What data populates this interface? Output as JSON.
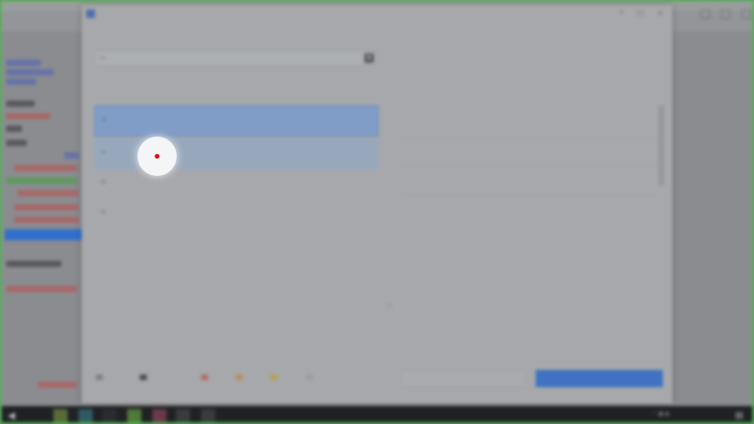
{
  "background_app": {
    "title": "",
    "rows": [
      {
        "color": "blue"
      },
      {
        "color": "blue"
      },
      {
        "color": "blue"
      },
      {
        "color": "dark"
      },
      {
        "color": "red"
      },
      {
        "color": "dark"
      },
      {
        "color": "dark"
      },
      {
        "color": "blue"
      },
      {
        "color": "red"
      },
      {
        "color": "green"
      },
      {
        "color": "red"
      },
      {
        "color": "red"
      },
      {
        "color": "red"
      },
      {
        "color": "red"
      }
    ],
    "bottom_label": "",
    "bottom_sub": ""
  },
  "dialog": {
    "title": "",
    "section_source": "",
    "dropdown": {
      "value": "",
      "icon": "folder-icon"
    },
    "section_left": "",
    "left_items": [
      {
        "title": "",
        "subtitle": "",
        "state": "selected"
      },
      {
        "title": "",
        "subtitle": "",
        "state": "hover"
      },
      {
        "title": "",
        "subtitle": "",
        "state": "normal"
      },
      {
        "title": "",
        "subtitle": "",
        "state": "normal"
      }
    ],
    "section_right": "",
    "right_items": [
      {
        "title": "",
        "subtitle": ""
      },
      {
        "title": "",
        "subtitle": ""
      },
      {
        "title": "",
        "subtitle": ""
      },
      {
        "title": "",
        "subtitle": ""
      }
    ],
    "section_preview": "",
    "preview_text": "",
    "legend": [
      {
        "label": "",
        "color": "#7c7e82"
      },
      {
        "label": "",
        "color": "#4a4b4e"
      },
      {
        "label": "",
        "color": "#b36a6a"
      },
      {
        "label": "",
        "color": "#b98d5a"
      },
      {
        "label": "",
        "color": "#b3a24f"
      },
      {
        "label": "",
        "color": "#9a9c9f"
      }
    ],
    "secondary_button": "",
    "primary_button": ""
  },
  "taskbar": {
    "apps": [
      {
        "icon": "search-icon",
        "active": false
      },
      {
        "icon": "folder-icon",
        "active": false
      },
      {
        "icon": "browser-icon",
        "active": false
      },
      {
        "icon": "terminal-icon",
        "active": false
      },
      {
        "icon": "app-icon",
        "active": false
      },
      {
        "icon": "app-icon",
        "active": false
      },
      {
        "icon": "app-icon",
        "active": false
      },
      {
        "icon": "app-icon",
        "active": true
      }
    ],
    "clock_time": "",
    "clock_date": ""
  },
  "colors": {
    "accent": "#3f72c2",
    "selection": "#2f6fcd",
    "highlight_frame": "#3ad13a"
  }
}
